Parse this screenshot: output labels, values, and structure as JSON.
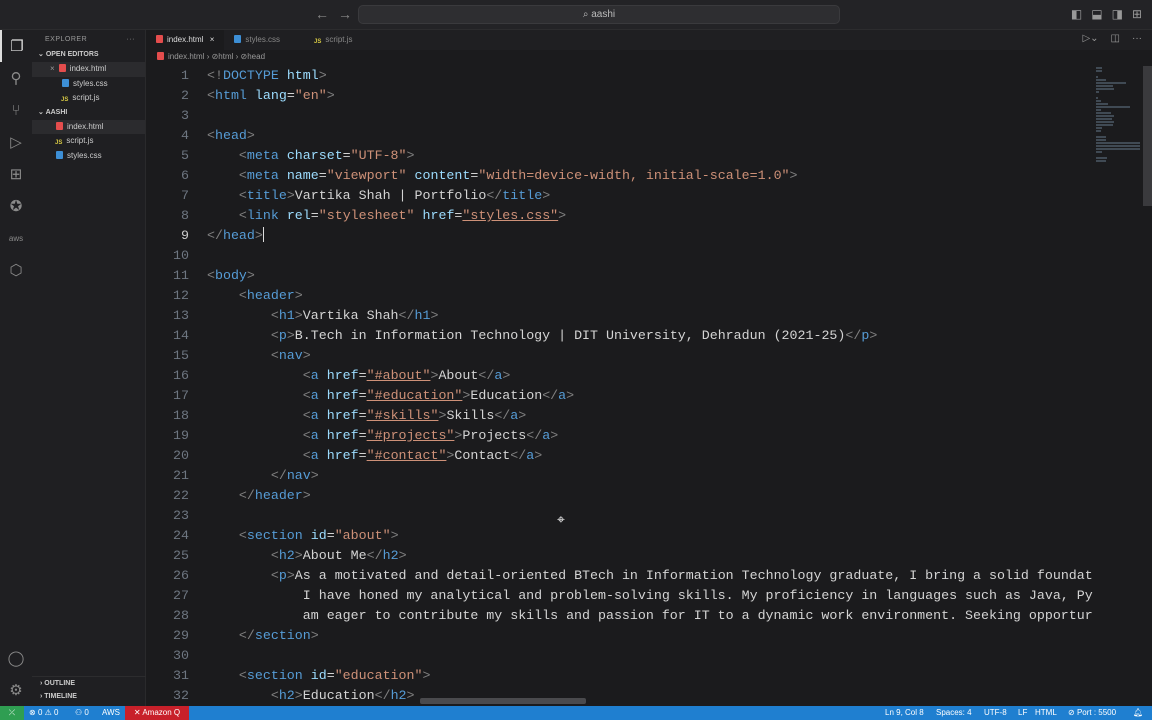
{
  "titlebar": {
    "search": "aashi",
    "back_icon": "arrow-left-icon",
    "forward_icon": "arrow-right-icon"
  },
  "activity_bar": [
    "files-icon",
    "search-icon",
    "source-control-icon",
    "run-debug-icon",
    "extensions-icon",
    "python-icon",
    "aws-icon",
    "amazon-q-icon"
  ],
  "sidebar": {
    "title": "EXPLORER",
    "more": "···",
    "open_editors": "OPEN EDITORS",
    "open_files": [
      {
        "name": "index.html",
        "type": "html"
      },
      {
        "name": "styles.css",
        "type": "css"
      },
      {
        "name": "script.js",
        "type": "js"
      }
    ],
    "folder": "AASHI",
    "files": [
      {
        "name": "index.html",
        "type": "html"
      },
      {
        "name": "script.js",
        "type": "js"
      },
      {
        "name": "styles.css",
        "type": "css"
      }
    ],
    "outline": "OUTLINE",
    "timeline": "TIMELINE"
  },
  "tabs": [
    {
      "name": "index.html",
      "type": "html",
      "active": true
    },
    {
      "name": "styles.css",
      "type": "css"
    },
    {
      "name": "script.js",
      "type": "js"
    }
  ],
  "breadcrumb": [
    "index.html",
    "html",
    "head"
  ],
  "cursor_line": 9,
  "code": [
    [
      [
        "p",
        "<!"
      ],
      [
        "t",
        "DOCTYPE"
      ],
      [
        "x",
        " "
      ],
      [
        "a",
        "html"
      ],
      [
        "p",
        ">"
      ]
    ],
    [
      [
        "p",
        "<"
      ],
      [
        "t",
        "html"
      ],
      [
        "x",
        " "
      ],
      [
        "a",
        "lang"
      ],
      [
        "x",
        "="
      ],
      [
        "s",
        "\"en\""
      ],
      [
        "p",
        ">"
      ]
    ],
    [],
    [
      [
        "p",
        "<"
      ],
      [
        "t",
        "head"
      ],
      [
        "p",
        ">"
      ]
    ],
    [
      [
        "x",
        "    "
      ],
      [
        "p",
        "<"
      ],
      [
        "t",
        "meta"
      ],
      [
        "x",
        " "
      ],
      [
        "a",
        "charset"
      ],
      [
        "x",
        "="
      ],
      [
        "s",
        "\"UTF-8\""
      ],
      [
        "p",
        ">"
      ]
    ],
    [
      [
        "x",
        "    "
      ],
      [
        "p",
        "<"
      ],
      [
        "t",
        "meta"
      ],
      [
        "x",
        " "
      ],
      [
        "a",
        "name"
      ],
      [
        "x",
        "="
      ],
      [
        "s",
        "\"viewport\""
      ],
      [
        "x",
        " "
      ],
      [
        "a",
        "content"
      ],
      [
        "x",
        "="
      ],
      [
        "s",
        "\"width=device-width, initial-scale=1.0\""
      ],
      [
        "p",
        ">"
      ]
    ],
    [
      [
        "x",
        "    "
      ],
      [
        "p",
        "<"
      ],
      [
        "t",
        "title"
      ],
      [
        "p",
        ">"
      ],
      [
        "x",
        "Vartika Shah | Portfolio"
      ],
      [
        "p",
        "</"
      ],
      [
        "t",
        "title"
      ],
      [
        "p",
        ">"
      ]
    ],
    [
      [
        "x",
        "    "
      ],
      [
        "p",
        "<"
      ],
      [
        "t",
        "link"
      ],
      [
        "x",
        " "
      ],
      [
        "a",
        "rel"
      ],
      [
        "x",
        "="
      ],
      [
        "s",
        "\"stylesheet\""
      ],
      [
        "x",
        " "
      ],
      [
        "a",
        "href"
      ],
      [
        "x",
        "="
      ],
      [
        "u",
        "\"styles.css\""
      ],
      [
        "p",
        ">"
      ]
    ],
    [
      [
        "p",
        "</"
      ],
      [
        "t",
        "head"
      ],
      [
        "p",
        ">"
      ]
    ],
    [],
    [
      [
        "p",
        "<"
      ],
      [
        "t",
        "body"
      ],
      [
        "p",
        ">"
      ]
    ],
    [
      [
        "x",
        "    "
      ],
      [
        "p",
        "<"
      ],
      [
        "t",
        "header"
      ],
      [
        "p",
        ">"
      ]
    ],
    [
      [
        "x",
        "        "
      ],
      [
        "p",
        "<"
      ],
      [
        "t",
        "h1"
      ],
      [
        "p",
        ">"
      ],
      [
        "x",
        "Vartika Shah"
      ],
      [
        "p",
        "</"
      ],
      [
        "t",
        "h1"
      ],
      [
        "p",
        ">"
      ]
    ],
    [
      [
        "x",
        "        "
      ],
      [
        "p",
        "<"
      ],
      [
        "t",
        "p"
      ],
      [
        "p",
        ">"
      ],
      [
        "x",
        "B.Tech in Information Technology | DIT University, Dehradun (2021-25)"
      ],
      [
        "p",
        "</"
      ],
      [
        "t",
        "p"
      ],
      [
        "p",
        ">"
      ]
    ],
    [
      [
        "x",
        "        "
      ],
      [
        "p",
        "<"
      ],
      [
        "t",
        "nav"
      ],
      [
        "p",
        ">"
      ]
    ],
    [
      [
        "x",
        "            "
      ],
      [
        "p",
        "<"
      ],
      [
        "t",
        "a"
      ],
      [
        "x",
        " "
      ],
      [
        "a",
        "href"
      ],
      [
        "x",
        "="
      ],
      [
        "u",
        "\"#about\""
      ],
      [
        "p",
        ">"
      ],
      [
        "x",
        "About"
      ],
      [
        "p",
        "</"
      ],
      [
        "t",
        "a"
      ],
      [
        "p",
        ">"
      ]
    ],
    [
      [
        "x",
        "            "
      ],
      [
        "p",
        "<"
      ],
      [
        "t",
        "a"
      ],
      [
        "x",
        " "
      ],
      [
        "a",
        "href"
      ],
      [
        "x",
        "="
      ],
      [
        "u",
        "\"#education\""
      ],
      [
        "p",
        ">"
      ],
      [
        "x",
        "Education"
      ],
      [
        "p",
        "</"
      ],
      [
        "t",
        "a"
      ],
      [
        "p",
        ">"
      ]
    ],
    [
      [
        "x",
        "            "
      ],
      [
        "p",
        "<"
      ],
      [
        "t",
        "a"
      ],
      [
        "x",
        " "
      ],
      [
        "a",
        "href"
      ],
      [
        "x",
        "="
      ],
      [
        "u",
        "\"#skills\""
      ],
      [
        "p",
        ">"
      ],
      [
        "x",
        "Skills"
      ],
      [
        "p",
        "</"
      ],
      [
        "t",
        "a"
      ],
      [
        "p",
        ">"
      ]
    ],
    [
      [
        "x",
        "            "
      ],
      [
        "p",
        "<"
      ],
      [
        "t",
        "a"
      ],
      [
        "x",
        " "
      ],
      [
        "a",
        "href"
      ],
      [
        "x",
        "="
      ],
      [
        "u",
        "\"#projects\""
      ],
      [
        "p",
        ">"
      ],
      [
        "x",
        "Projects"
      ],
      [
        "p",
        "</"
      ],
      [
        "t",
        "a"
      ],
      [
        "p",
        ">"
      ]
    ],
    [
      [
        "x",
        "            "
      ],
      [
        "p",
        "<"
      ],
      [
        "t",
        "a"
      ],
      [
        "x",
        " "
      ],
      [
        "a",
        "href"
      ],
      [
        "x",
        "="
      ],
      [
        "u",
        "\"#contact\""
      ],
      [
        "p",
        ">"
      ],
      [
        "x",
        "Contact"
      ],
      [
        "p",
        "</"
      ],
      [
        "t",
        "a"
      ],
      [
        "p",
        ">"
      ]
    ],
    [
      [
        "x",
        "        "
      ],
      [
        "p",
        "</"
      ],
      [
        "t",
        "nav"
      ],
      [
        "p",
        ">"
      ]
    ],
    [
      [
        "x",
        "    "
      ],
      [
        "p",
        "</"
      ],
      [
        "t",
        "header"
      ],
      [
        "p",
        ">"
      ]
    ],
    [],
    [
      [
        "x",
        "    "
      ],
      [
        "p",
        "<"
      ],
      [
        "t",
        "section"
      ],
      [
        "x",
        " "
      ],
      [
        "a",
        "id"
      ],
      [
        "x",
        "="
      ],
      [
        "s",
        "\"about\""
      ],
      [
        "p",
        ">"
      ]
    ],
    [
      [
        "x",
        "        "
      ],
      [
        "p",
        "<"
      ],
      [
        "t",
        "h2"
      ],
      [
        "p",
        ">"
      ],
      [
        "x",
        "About Me"
      ],
      [
        "p",
        "</"
      ],
      [
        "t",
        "h2"
      ],
      [
        "p",
        ">"
      ]
    ],
    [
      [
        "x",
        "        "
      ],
      [
        "p",
        "<"
      ],
      [
        "t",
        "p"
      ],
      [
        "p",
        ">"
      ],
      [
        "x",
        "As a motivated and detail-oriented BTech in Information Technology graduate, I bring a solid foundat"
      ]
    ],
    [
      [
        "x",
        "            I have honed my analytical and problem-solving skills. My proficiency in languages such as Java, Py"
      ]
    ],
    [
      [
        "x",
        "            am eager to contribute my skills and passion for IT to a dynamic work environment. Seeking opportur"
      ]
    ],
    [
      [
        "x",
        "    "
      ],
      [
        "p",
        "</"
      ],
      [
        "t",
        "section"
      ],
      [
        "p",
        ">"
      ]
    ],
    [],
    [
      [
        "x",
        "    "
      ],
      [
        "p",
        "<"
      ],
      [
        "t",
        "section"
      ],
      [
        "x",
        " "
      ],
      [
        "a",
        "id"
      ],
      [
        "x",
        "="
      ],
      [
        "s",
        "\"education\""
      ],
      [
        "p",
        ">"
      ]
    ],
    [
      [
        "x",
        "        "
      ],
      [
        "p",
        "<"
      ],
      [
        "t",
        "h2"
      ],
      [
        "p",
        ">"
      ],
      [
        "x",
        "Education"
      ],
      [
        "p",
        "</"
      ],
      [
        "t",
        "h2"
      ],
      [
        "p",
        ">"
      ]
    ]
  ],
  "status": {
    "errors": "0",
    "warnings": "0",
    "ports": "0",
    "aws": "AWS",
    "amazon_q": "Amazon Q",
    "position": "Ln 9, Col 8",
    "spaces": "Spaces: 4",
    "encoding": "UTF-8",
    "eol": "LF",
    "language": "HTML",
    "port": "Port : 5500"
  }
}
